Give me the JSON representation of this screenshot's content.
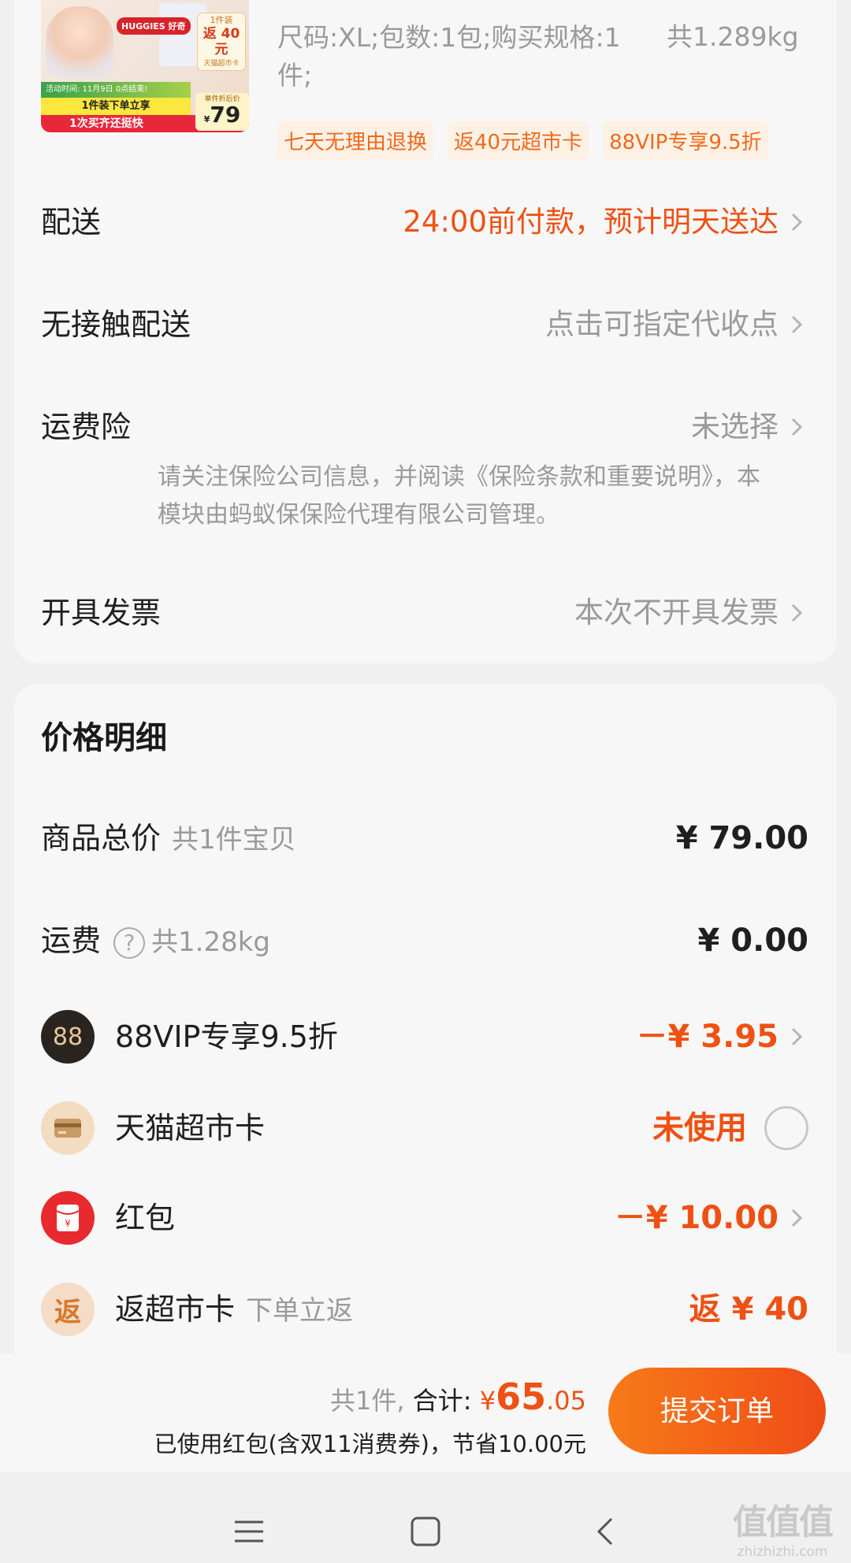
{
  "product": {
    "image": {
      "brand": "HUGGIES 好奇",
      "tag_top": "1件装",
      "tag_amount": "返 40 元",
      "tag_sub": "天猫超市卡",
      "banner": "活动时间: 11月9日 0点结束!",
      "line1": "1件装下单立享",
      "line2": "1次买齐还挺快",
      "price_label": "单件折后价",
      "price_yen": "¥",
      "price_value": "79"
    },
    "spec": "尺码:XL;包数:1包;购买规格:1件;",
    "weight": "共1.289kg",
    "tags": [
      "七天无理由退换",
      "返40元超市卡",
      "88VIP专享9.5折"
    ]
  },
  "options": {
    "delivery": {
      "label": "配送",
      "value": "24:00前付款，预计明天送达"
    },
    "contactless": {
      "label": "无接触配送",
      "value": "点击可指定代收点"
    },
    "insurance": {
      "label": "运费险",
      "value": "未选择",
      "note": "请关注保险公司信息，并阅读《保险条款和重要说明》，本模块由蚂蚁保保险代理有限公司管理。"
    },
    "invoice": {
      "label": "开具发票",
      "value": "本次不开具发票"
    }
  },
  "price_detail": {
    "title": "价格明细",
    "goods_total": {
      "label": "商品总价",
      "sub": "共1件宝贝",
      "amount": "¥ 79.00"
    },
    "shipping": {
      "label": "运费",
      "help": "?",
      "sub": "共1.28kg",
      "amount": "¥ 0.00"
    },
    "vip": {
      "icon": "88",
      "label": "88VIP专享9.5折",
      "amount": "－¥ 3.95"
    },
    "supermarket_card": {
      "label": "天猫超市卡",
      "amount": "未使用"
    },
    "red_packet": {
      "label": "红包",
      "amount": "－¥ 10.00"
    },
    "cashback": {
      "icon": "返",
      "label": "返超市卡",
      "sub": "下单立返",
      "amount": "返 ¥ 40"
    }
  },
  "checkout": {
    "count": "共1件,",
    "total_label": "合计:",
    "yen": "¥",
    "total_int": "65",
    "total_dec": ".05",
    "saved": "已使用红包(含双11消费券)，节省10.00元",
    "submit": "提交订单"
  },
  "watermark": {
    "line1": "值值值",
    "line2": "zhizhizhi.com"
  },
  "colors": {
    "accent": "#ee5113",
    "button_start": "#f77a18",
    "button_end": "#f04c17"
  }
}
